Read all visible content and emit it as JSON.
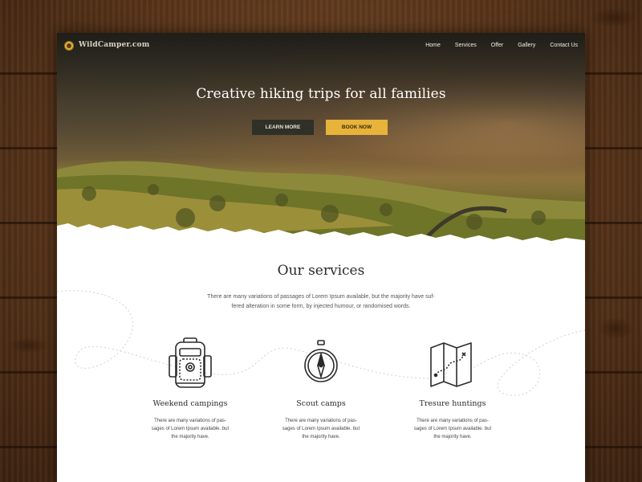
{
  "brand": {
    "name": "WildCamper.com"
  },
  "nav": {
    "items": [
      "Home",
      "Services",
      "Offer",
      "Gallery",
      "Contact Us"
    ]
  },
  "hero": {
    "title": "Creative hiking trips for all families",
    "learn_more_label": "LEARN MORE",
    "book_now_label": "BOOK NOW"
  },
  "services": {
    "title": "Our services",
    "intro": "There are many variations of passages of Lorem Ipsum available, but the majority have suf-fered alteration in some form, by injected humour, or randomised words.",
    "items": [
      {
        "icon": "backpack-icon",
        "title": "Weekend campings",
        "text": "There are many variations of pas-sages of Lorem Ipsum available. but the majority have."
      },
      {
        "icon": "compass-icon",
        "title": "Scout camps",
        "text": "There are many variations of pas-sages of Lorem Ipsum available. but the majority have."
      },
      {
        "icon": "map-icon",
        "title": "Tresure huntings",
        "text": "There are many variations of pas-sages of Lorem Ipsum available. but the majority have."
      }
    ]
  },
  "colors": {
    "accent": "#e8b33a",
    "dark_button": "#2f3027",
    "wood": "#5a3519"
  }
}
